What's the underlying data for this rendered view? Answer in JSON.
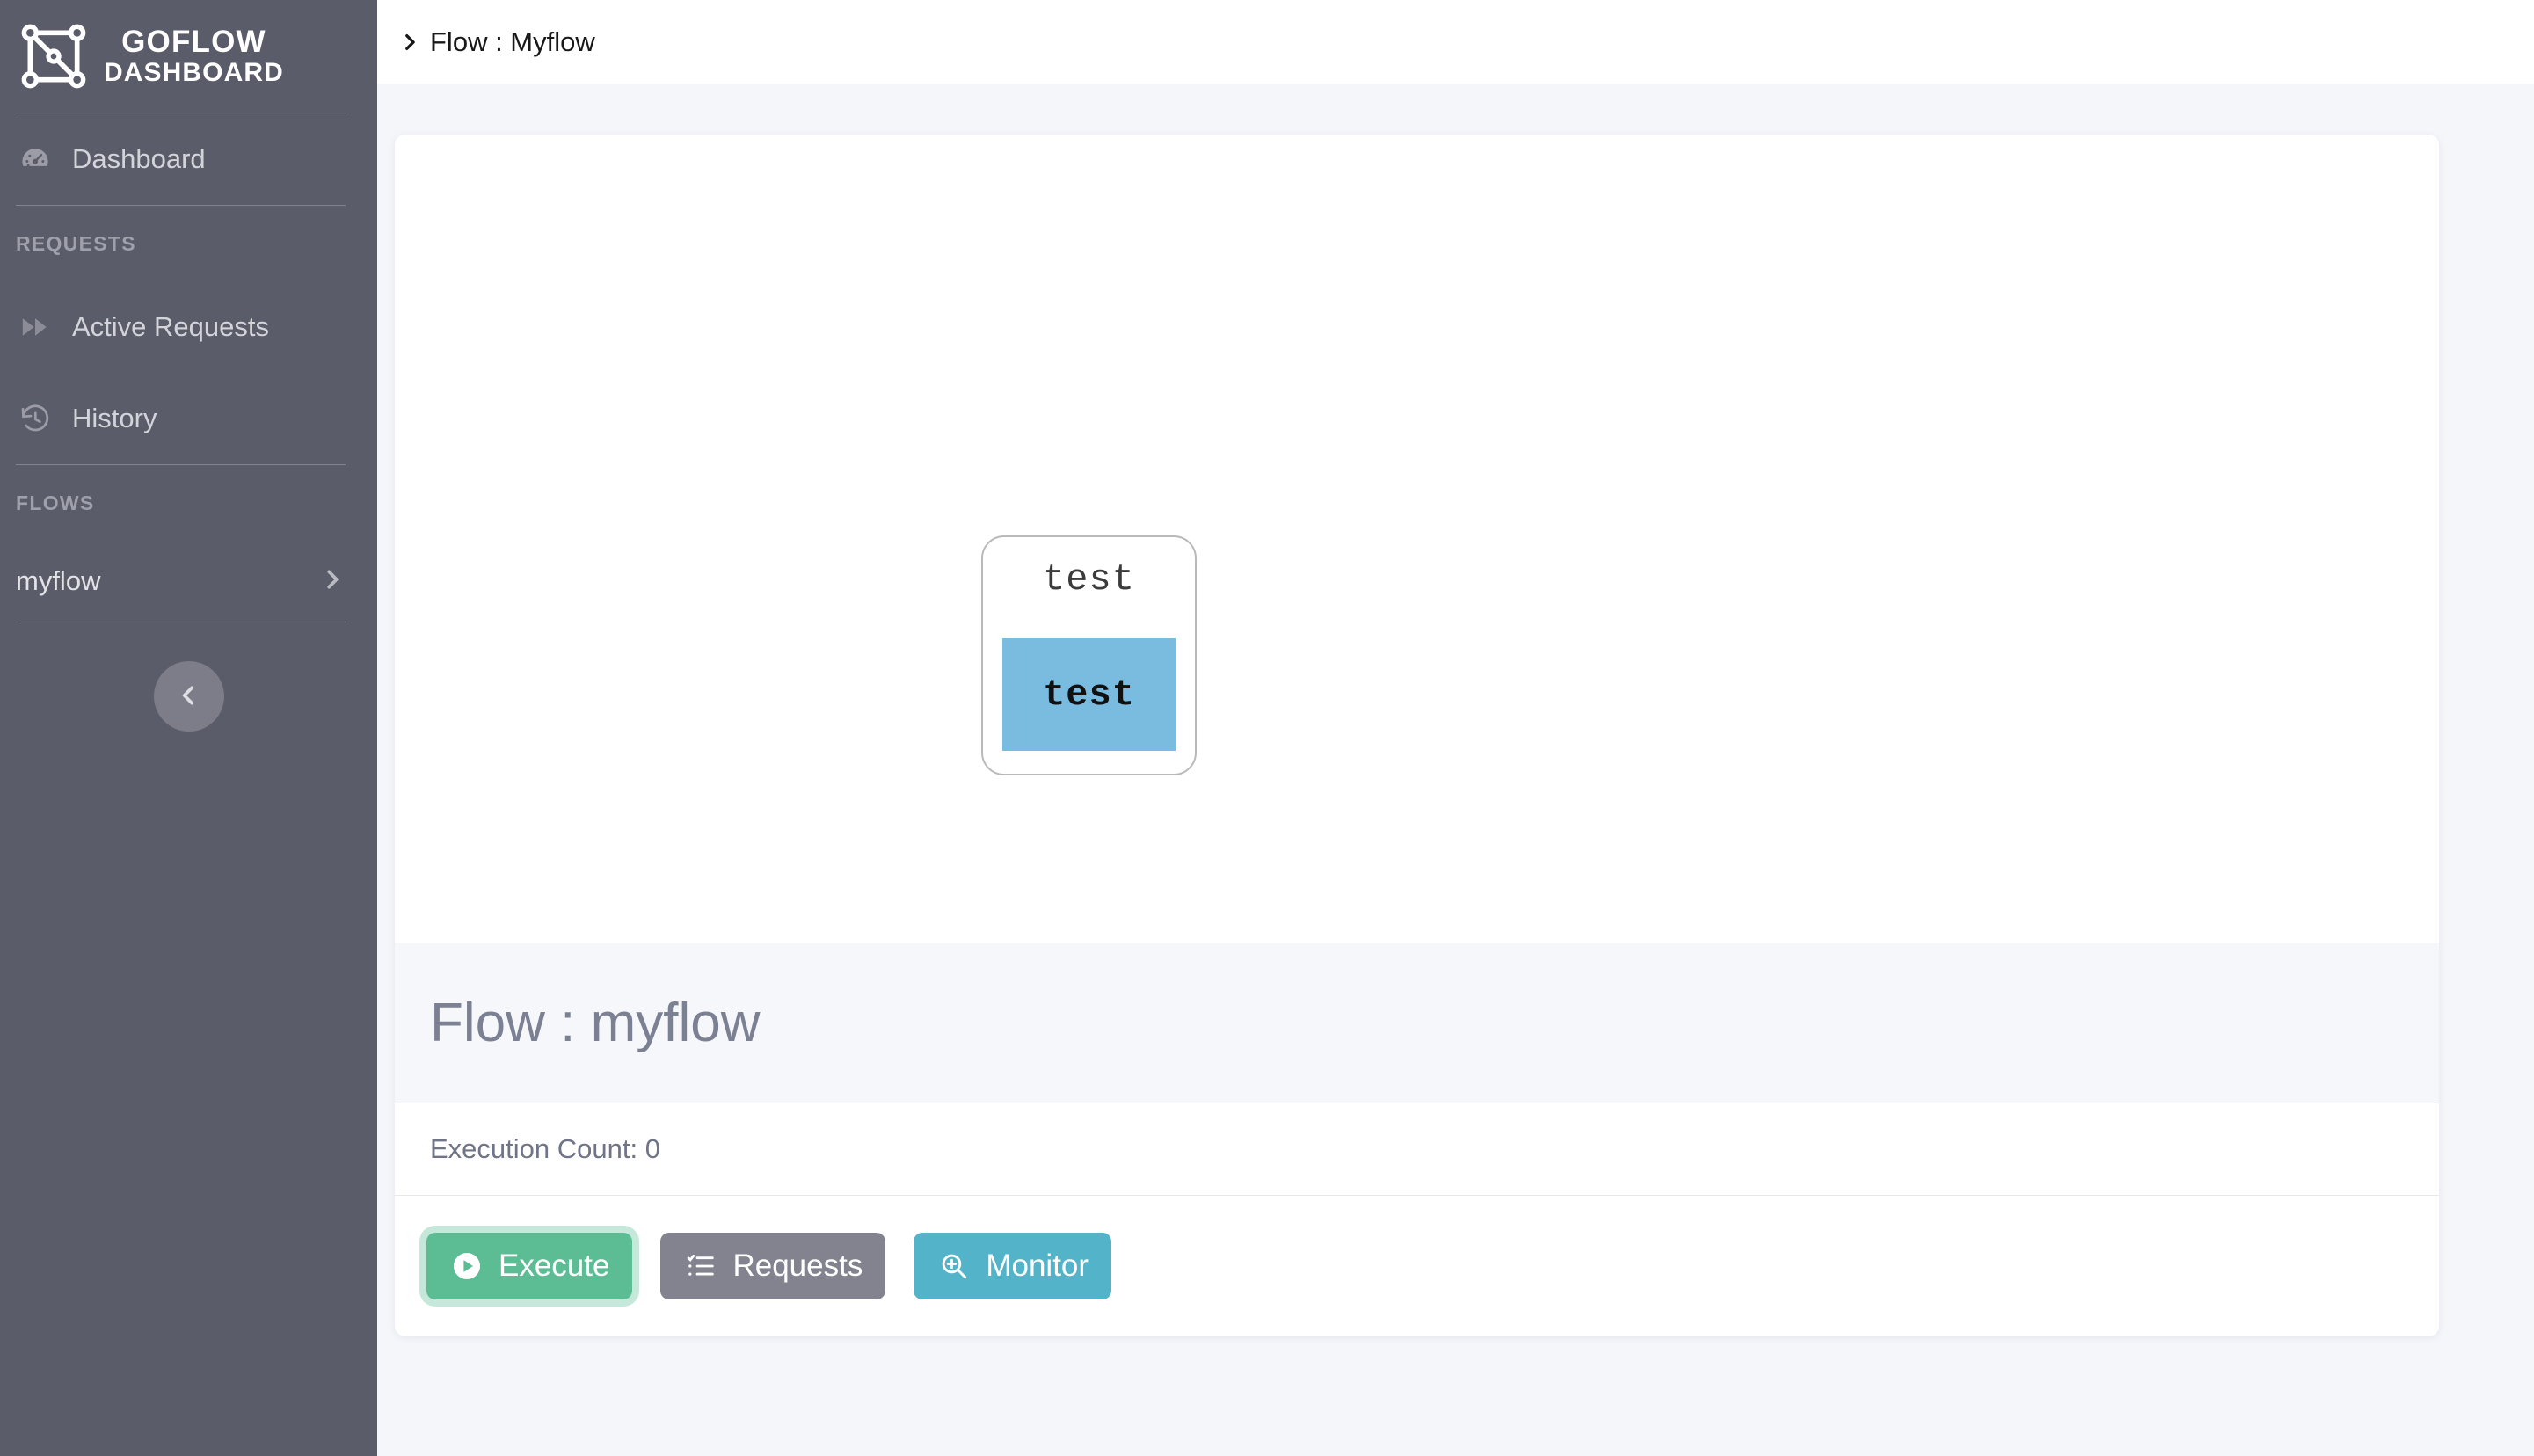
{
  "sidebar": {
    "brand": {
      "logo_icon": "graph-nodes-icon",
      "title": "GOFLOW",
      "subtitle": "DASHBOARD"
    },
    "items": [
      {
        "label": "Dashboard",
        "icon": "speedometer-icon"
      },
      {
        "label": "Active Requests",
        "icon": "fast-forward-icon"
      },
      {
        "label": "History",
        "icon": "history-clock-icon"
      }
    ],
    "sections": [
      {
        "label": "REQUESTS"
      },
      {
        "label": "FLOWS"
      }
    ],
    "flows": [
      {
        "name": "myflow",
        "chevron_icon": "chevron-right-icon"
      }
    ],
    "collapse_button": {
      "icon": "chevron-left-icon"
    },
    "colors": {
      "background": "#5b5c69",
      "text": "#d3d4d9",
      "section_text": "#9fa0ab",
      "divider": "#82838f",
      "collapse_bg": "#7c7d88"
    }
  },
  "topbar": {
    "breadcrumb_icon": "chevron-right-icon",
    "breadcrumb": "Flow : Myflow"
  },
  "flow_canvas": {
    "node": {
      "title": "test",
      "body_label": "test",
      "body_color": "#79bce0",
      "border_color": "#b9b9b9"
    }
  },
  "flow_details": {
    "title": "Flow : myflow",
    "execution_count_label": "Execution Count: 0",
    "buttons": [
      {
        "label": "Execute",
        "icon": "play-circle-icon",
        "color": "#5cbd95",
        "focused": true
      },
      {
        "label": "Requests",
        "icon": "list-task-icon",
        "color": "#83838f",
        "focused": false
      },
      {
        "label": "Monitor",
        "icon": "zoom-in-icon",
        "color": "#52b3c9",
        "focused": false
      }
    ]
  },
  "page_colors": {
    "main_background": "#f5f6fa",
    "card_background": "#ffffff",
    "header_background": "#f6f7fa",
    "title_text": "#7c8093"
  }
}
